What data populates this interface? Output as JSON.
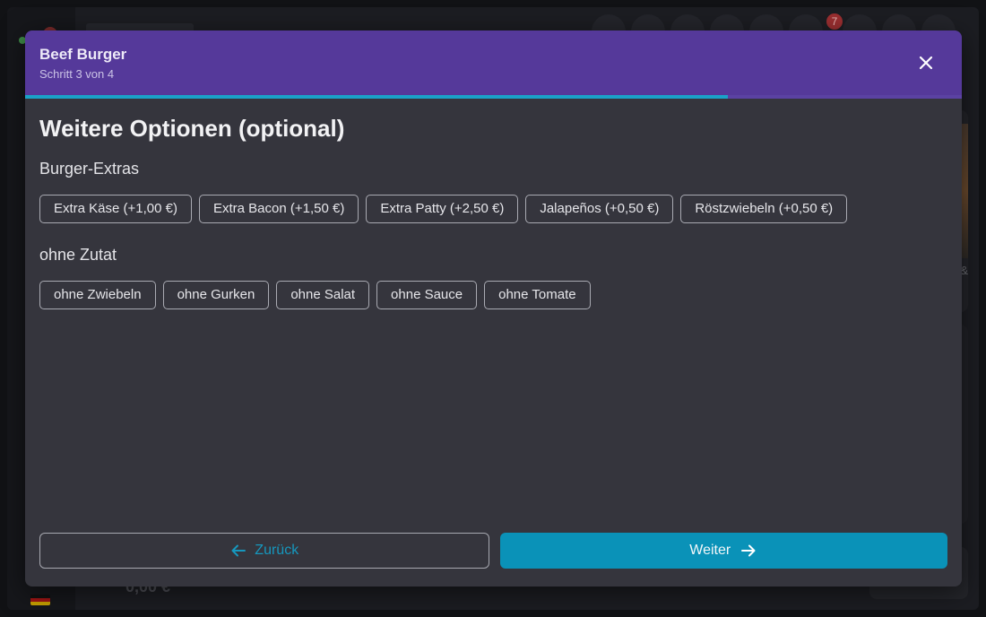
{
  "background": {
    "cart_badge": "7"
  },
  "modal": {
    "title": "Beef Burger",
    "subtitle": "Schritt 3 von 4",
    "progress": 0.75,
    "heading": "Weitere Optionen (optional)",
    "groups": [
      {
        "label": "Burger-Extras",
        "options": [
          "Extra Käse (+1,00 €)",
          "Extra Bacon (+1,50 €)",
          "Extra Patty (+2,50 €)",
          "Jalapeños (+0,50 €)",
          "Röstzwiebeln (+0,50 €)"
        ]
      },
      {
        "label": "ohne Zutat",
        "options": [
          "ohne Zwiebeln",
          "ohne Gurken",
          "ohne Salat",
          "ohne Sauce",
          "ohne Tomate"
        ]
      }
    ],
    "back_label": "Zurück",
    "next_label": "Weiter"
  },
  "colors": {
    "header": "#55399a",
    "accent": "#0a92b8",
    "panel": "#35353d"
  },
  "icons": {
    "close": "close-icon",
    "back": "arrow-left-icon",
    "next": "arrow-right-icon"
  }
}
